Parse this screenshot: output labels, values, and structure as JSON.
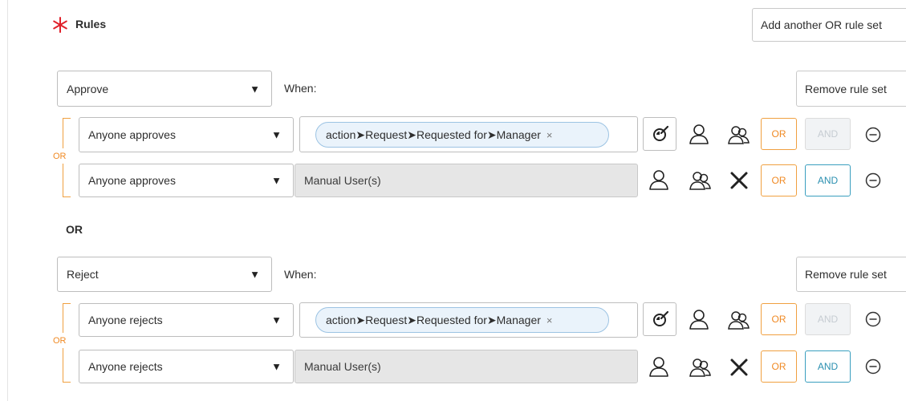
{
  "header": {
    "title": "Rules",
    "add_button": "Add another OR rule set"
  },
  "separator_or": "OR",
  "rule_sets": [
    {
      "action_select": "Approve",
      "when_label": "When:",
      "remove_button": "Remove rule set",
      "group_or_label": "OR",
      "rows": [
        {
          "condition_select": "Anyone approves",
          "pill_text": "action➤Request➤Requested for➤Manager",
          "pill_close": "×",
          "or_label": "OR",
          "and_label": "AND",
          "and_enabled": false
        },
        {
          "condition_select": "Anyone approves",
          "manual_text": "Manual User(s)",
          "or_label": "OR",
          "and_label": "AND",
          "and_enabled": true
        }
      ]
    },
    {
      "action_select": "Reject",
      "when_label": "When:",
      "remove_button": "Remove rule set",
      "group_or_label": "OR",
      "rows": [
        {
          "condition_select": "Anyone rejects",
          "pill_text": "action➤Request➤Requested for➤Manager",
          "pill_close": "×",
          "or_label": "OR",
          "and_label": "AND",
          "and_enabled": false
        },
        {
          "condition_select": "Anyone rejects",
          "manual_text": "Manual User(s)",
          "or_label": "OR",
          "and_label": "AND",
          "and_enabled": true
        }
      ]
    }
  ],
  "icons": {
    "required": "asterisk-icon",
    "caret": "caret-down-icon",
    "script": "script-wand-icon",
    "user": "user-icon",
    "group": "group-icon",
    "clear": "close-icon",
    "remove_row": "minus-circle-icon"
  },
  "colors": {
    "required_star": "#e0212b",
    "or_accent": "#f08a24",
    "and_accent": "#2a8fb0",
    "pill_bg": "#eaf3fb",
    "manual_bg": "#e6e6e6"
  }
}
